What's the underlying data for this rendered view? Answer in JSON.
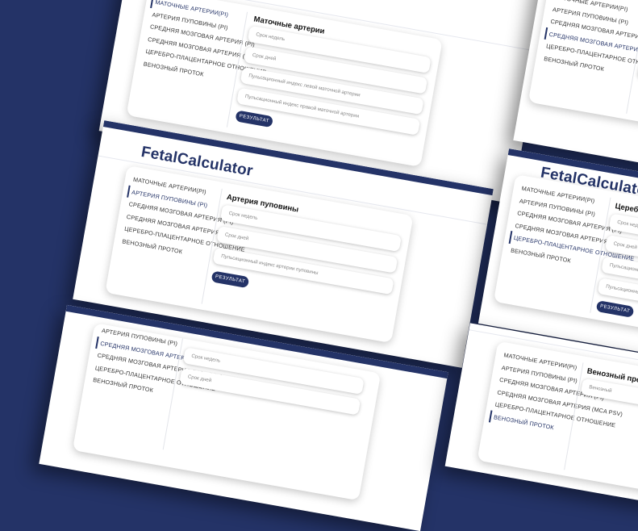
{
  "app": {
    "brand": "FetalCalculator",
    "brand_partial": "alcalculator"
  },
  "menu": {
    "items": [
      "МАТОЧНЫЕ АРТЕРИИ(PI)",
      "АРТЕРИЯ ПУПОВИНЫ (PI)",
      "СРЕДНЯЯ МОЗГОВАЯ АРТЕРИЯ (PI)",
      "СРЕДНЯЯ МОЗГОВАЯ АРТЕРИЯ (MCA PSV)",
      "ЦЕРЕБРО-ПЛАЦЕНТАРНОЕ ОТНОШЕНИЕ",
      "ВЕНОЗНЫЙ ПРОТОК"
    ]
  },
  "forms": {
    "uterine": {
      "title": "Маточные артерии",
      "fields": [
        "Срок недель",
        "Срок дней",
        "Пульсационный индекс левой маточной артерии",
        "Пульсационный индекс правой маточной артерии"
      ]
    },
    "umbilical": {
      "title": "Артерия пуповины",
      "fields": [
        "Срок недель",
        "Срок дней",
        "Пульсационный индекс артерии пуповины"
      ]
    },
    "cerebral": {
      "fields": [
        "Срок недель",
        "Срок дней"
      ]
    },
    "cpr": {
      "title": "Церебро-",
      "fields": [
        "Срок недель",
        "Срок дней",
        "Пульсационный",
        "Пульсационный инд"
      ]
    },
    "venous": {
      "title": "Венозный проток",
      "fields": [
        "Венозный"
      ]
    },
    "partial_field": "MC"
  },
  "actions": {
    "result_label": "РЕЗУЛЬТАТ",
    "result_partial": "РЕ"
  }
}
